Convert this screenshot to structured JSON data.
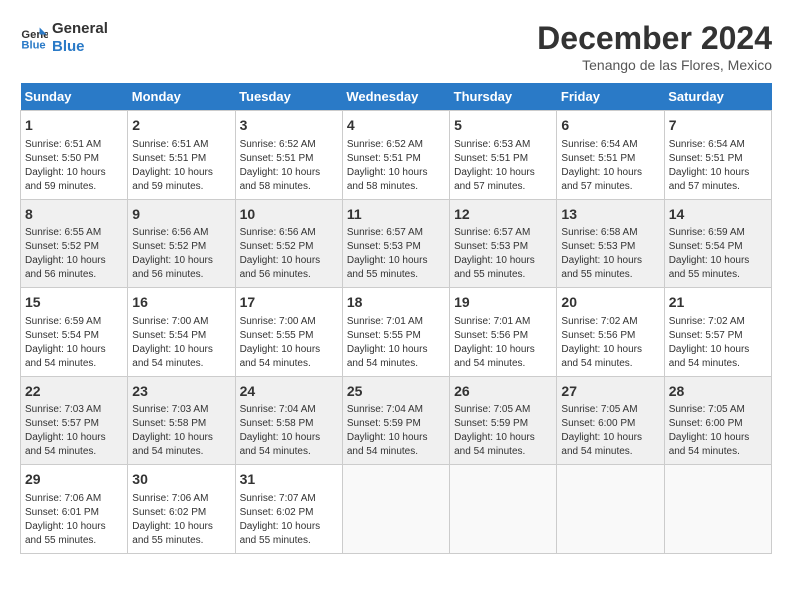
{
  "logo": {
    "line1": "General",
    "line2": "Blue"
  },
  "title": "December 2024",
  "location": "Tenango de las Flores, Mexico",
  "days_of_week": [
    "Sunday",
    "Monday",
    "Tuesday",
    "Wednesday",
    "Thursday",
    "Friday",
    "Saturday"
  ],
  "weeks": [
    [
      {
        "day": "1",
        "sunrise": "6:51 AM",
        "sunset": "5:50 PM",
        "daylight": "10 hours and 59 minutes."
      },
      {
        "day": "2",
        "sunrise": "6:51 AM",
        "sunset": "5:51 PM",
        "daylight": "10 hours and 59 minutes."
      },
      {
        "day": "3",
        "sunrise": "6:52 AM",
        "sunset": "5:51 PM",
        "daylight": "10 hours and 58 minutes."
      },
      {
        "day": "4",
        "sunrise": "6:52 AM",
        "sunset": "5:51 PM",
        "daylight": "10 hours and 58 minutes."
      },
      {
        "day": "5",
        "sunrise": "6:53 AM",
        "sunset": "5:51 PM",
        "daylight": "10 hours and 57 minutes."
      },
      {
        "day": "6",
        "sunrise": "6:54 AM",
        "sunset": "5:51 PM",
        "daylight": "10 hours and 57 minutes."
      },
      {
        "day": "7",
        "sunrise": "6:54 AM",
        "sunset": "5:51 PM",
        "daylight": "10 hours and 57 minutes."
      }
    ],
    [
      {
        "day": "8",
        "sunrise": "6:55 AM",
        "sunset": "5:52 PM",
        "daylight": "10 hours and 56 minutes."
      },
      {
        "day": "9",
        "sunrise": "6:56 AM",
        "sunset": "5:52 PM",
        "daylight": "10 hours and 56 minutes."
      },
      {
        "day": "10",
        "sunrise": "6:56 AM",
        "sunset": "5:52 PM",
        "daylight": "10 hours and 56 minutes."
      },
      {
        "day": "11",
        "sunrise": "6:57 AM",
        "sunset": "5:53 PM",
        "daylight": "10 hours and 55 minutes."
      },
      {
        "day": "12",
        "sunrise": "6:57 AM",
        "sunset": "5:53 PM",
        "daylight": "10 hours and 55 minutes."
      },
      {
        "day": "13",
        "sunrise": "6:58 AM",
        "sunset": "5:53 PM",
        "daylight": "10 hours and 55 minutes."
      },
      {
        "day": "14",
        "sunrise": "6:59 AM",
        "sunset": "5:54 PM",
        "daylight": "10 hours and 55 minutes."
      }
    ],
    [
      {
        "day": "15",
        "sunrise": "6:59 AM",
        "sunset": "5:54 PM",
        "daylight": "10 hours and 54 minutes."
      },
      {
        "day": "16",
        "sunrise": "7:00 AM",
        "sunset": "5:54 PM",
        "daylight": "10 hours and 54 minutes."
      },
      {
        "day": "17",
        "sunrise": "7:00 AM",
        "sunset": "5:55 PM",
        "daylight": "10 hours and 54 minutes."
      },
      {
        "day": "18",
        "sunrise": "7:01 AM",
        "sunset": "5:55 PM",
        "daylight": "10 hours and 54 minutes."
      },
      {
        "day": "19",
        "sunrise": "7:01 AM",
        "sunset": "5:56 PM",
        "daylight": "10 hours and 54 minutes."
      },
      {
        "day": "20",
        "sunrise": "7:02 AM",
        "sunset": "5:56 PM",
        "daylight": "10 hours and 54 minutes."
      },
      {
        "day": "21",
        "sunrise": "7:02 AM",
        "sunset": "5:57 PM",
        "daylight": "10 hours and 54 minutes."
      }
    ],
    [
      {
        "day": "22",
        "sunrise": "7:03 AM",
        "sunset": "5:57 PM",
        "daylight": "10 hours and 54 minutes."
      },
      {
        "day": "23",
        "sunrise": "7:03 AM",
        "sunset": "5:58 PM",
        "daylight": "10 hours and 54 minutes."
      },
      {
        "day": "24",
        "sunrise": "7:04 AM",
        "sunset": "5:58 PM",
        "daylight": "10 hours and 54 minutes."
      },
      {
        "day": "25",
        "sunrise": "7:04 AM",
        "sunset": "5:59 PM",
        "daylight": "10 hours and 54 minutes."
      },
      {
        "day": "26",
        "sunrise": "7:05 AM",
        "sunset": "5:59 PM",
        "daylight": "10 hours and 54 minutes."
      },
      {
        "day": "27",
        "sunrise": "7:05 AM",
        "sunset": "6:00 PM",
        "daylight": "10 hours and 54 minutes."
      },
      {
        "day": "28",
        "sunrise": "7:05 AM",
        "sunset": "6:00 PM",
        "daylight": "10 hours and 54 minutes."
      }
    ],
    [
      {
        "day": "29",
        "sunrise": "7:06 AM",
        "sunset": "6:01 PM",
        "daylight": "10 hours and 55 minutes."
      },
      {
        "day": "30",
        "sunrise": "7:06 AM",
        "sunset": "6:02 PM",
        "daylight": "10 hours and 55 minutes."
      },
      {
        "day": "31",
        "sunrise": "7:07 AM",
        "sunset": "6:02 PM",
        "daylight": "10 hours and 55 minutes."
      },
      null,
      null,
      null,
      null
    ]
  ]
}
